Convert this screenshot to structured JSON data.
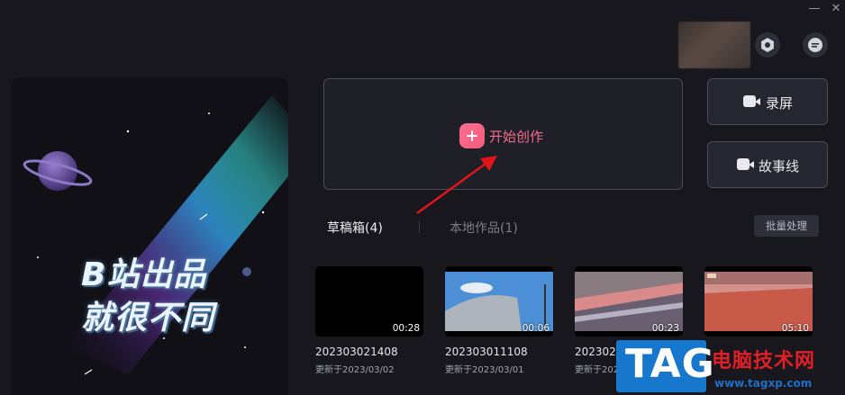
{
  "window": {
    "minimize": "—",
    "close": "✕"
  },
  "header": {
    "settings_icon": "gear-icon",
    "feedback_icon": "message-icon"
  },
  "banner": {
    "line1": "B站出品",
    "line2": "就很不同"
  },
  "start": {
    "label": "开始创作",
    "icon": "plus-icon"
  },
  "side_buttons": [
    {
      "label": "录屏",
      "icon": "camera-icon"
    },
    {
      "label": "故事线",
      "icon": "camera-icon"
    }
  ],
  "tabs": [
    {
      "label": "草稿箱(4)",
      "active": true
    },
    {
      "label": "本地作品(1)",
      "active": false
    }
  ],
  "batch_label": "批量处理",
  "drafts": [
    {
      "name": "202303021408",
      "date": "更新于2023/03/02",
      "duration": "00:28"
    },
    {
      "name": "202303011108",
      "date": "更新于2023/03/01",
      "duration": "00:06"
    },
    {
      "name": "2023021",
      "date": "更新于2023/",
      "duration": "00:23"
    },
    {
      "name": "",
      "date": "",
      "duration": "05:10"
    }
  ],
  "watermark": {
    "tag": "TAG",
    "site_name": "电脑技术网",
    "url": "www.tagxp.com"
  },
  "colors": {
    "accent": "#f76b8f",
    "background": "#17171d",
    "arrow": "#e0161b"
  }
}
